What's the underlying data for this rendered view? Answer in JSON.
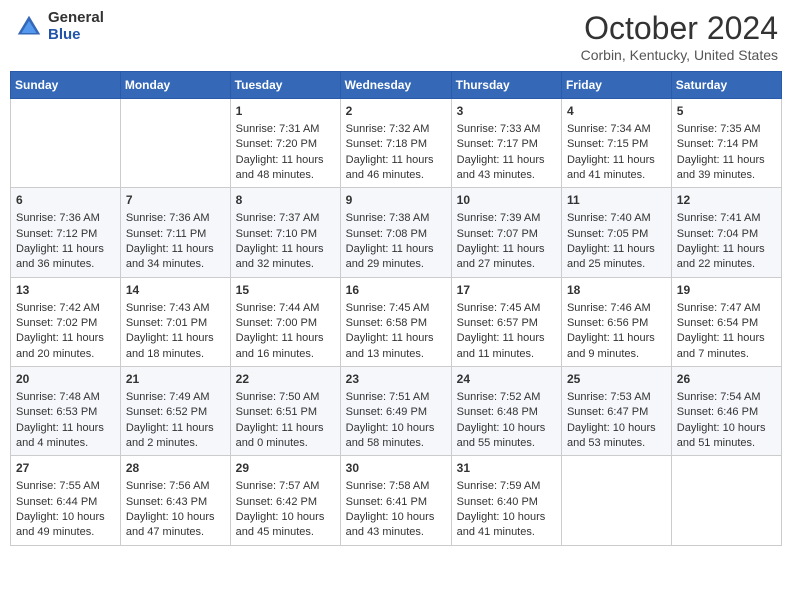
{
  "header": {
    "logo_general": "General",
    "logo_blue": "Blue",
    "month_title": "October 2024",
    "location": "Corbin, Kentucky, United States"
  },
  "days_of_week": [
    "Sunday",
    "Monday",
    "Tuesday",
    "Wednesday",
    "Thursday",
    "Friday",
    "Saturday"
  ],
  "weeks": [
    [
      {
        "day": "",
        "sunrise": "",
        "sunset": "",
        "daylight": ""
      },
      {
        "day": "",
        "sunrise": "",
        "sunset": "",
        "daylight": ""
      },
      {
        "day": "1",
        "sunrise": "Sunrise: 7:31 AM",
        "sunset": "Sunset: 7:20 PM",
        "daylight": "Daylight: 11 hours and 48 minutes."
      },
      {
        "day": "2",
        "sunrise": "Sunrise: 7:32 AM",
        "sunset": "Sunset: 7:18 PM",
        "daylight": "Daylight: 11 hours and 46 minutes."
      },
      {
        "day": "3",
        "sunrise": "Sunrise: 7:33 AM",
        "sunset": "Sunset: 7:17 PM",
        "daylight": "Daylight: 11 hours and 43 minutes."
      },
      {
        "day": "4",
        "sunrise": "Sunrise: 7:34 AM",
        "sunset": "Sunset: 7:15 PM",
        "daylight": "Daylight: 11 hours and 41 minutes."
      },
      {
        "day": "5",
        "sunrise": "Sunrise: 7:35 AM",
        "sunset": "Sunset: 7:14 PM",
        "daylight": "Daylight: 11 hours and 39 minutes."
      }
    ],
    [
      {
        "day": "6",
        "sunrise": "Sunrise: 7:36 AM",
        "sunset": "Sunset: 7:12 PM",
        "daylight": "Daylight: 11 hours and 36 minutes."
      },
      {
        "day": "7",
        "sunrise": "Sunrise: 7:36 AM",
        "sunset": "Sunset: 7:11 PM",
        "daylight": "Daylight: 11 hours and 34 minutes."
      },
      {
        "day": "8",
        "sunrise": "Sunrise: 7:37 AM",
        "sunset": "Sunset: 7:10 PM",
        "daylight": "Daylight: 11 hours and 32 minutes."
      },
      {
        "day": "9",
        "sunrise": "Sunrise: 7:38 AM",
        "sunset": "Sunset: 7:08 PM",
        "daylight": "Daylight: 11 hours and 29 minutes."
      },
      {
        "day": "10",
        "sunrise": "Sunrise: 7:39 AM",
        "sunset": "Sunset: 7:07 PM",
        "daylight": "Daylight: 11 hours and 27 minutes."
      },
      {
        "day": "11",
        "sunrise": "Sunrise: 7:40 AM",
        "sunset": "Sunset: 7:05 PM",
        "daylight": "Daylight: 11 hours and 25 minutes."
      },
      {
        "day": "12",
        "sunrise": "Sunrise: 7:41 AM",
        "sunset": "Sunset: 7:04 PM",
        "daylight": "Daylight: 11 hours and 22 minutes."
      }
    ],
    [
      {
        "day": "13",
        "sunrise": "Sunrise: 7:42 AM",
        "sunset": "Sunset: 7:02 PM",
        "daylight": "Daylight: 11 hours and 20 minutes."
      },
      {
        "day": "14",
        "sunrise": "Sunrise: 7:43 AM",
        "sunset": "Sunset: 7:01 PM",
        "daylight": "Daylight: 11 hours and 18 minutes."
      },
      {
        "day": "15",
        "sunrise": "Sunrise: 7:44 AM",
        "sunset": "Sunset: 7:00 PM",
        "daylight": "Daylight: 11 hours and 16 minutes."
      },
      {
        "day": "16",
        "sunrise": "Sunrise: 7:45 AM",
        "sunset": "Sunset: 6:58 PM",
        "daylight": "Daylight: 11 hours and 13 minutes."
      },
      {
        "day": "17",
        "sunrise": "Sunrise: 7:45 AM",
        "sunset": "Sunset: 6:57 PM",
        "daylight": "Daylight: 11 hours and 11 minutes."
      },
      {
        "day": "18",
        "sunrise": "Sunrise: 7:46 AM",
        "sunset": "Sunset: 6:56 PM",
        "daylight": "Daylight: 11 hours and 9 minutes."
      },
      {
        "day": "19",
        "sunrise": "Sunrise: 7:47 AM",
        "sunset": "Sunset: 6:54 PM",
        "daylight": "Daylight: 11 hours and 7 minutes."
      }
    ],
    [
      {
        "day": "20",
        "sunrise": "Sunrise: 7:48 AM",
        "sunset": "Sunset: 6:53 PM",
        "daylight": "Daylight: 11 hours and 4 minutes."
      },
      {
        "day": "21",
        "sunrise": "Sunrise: 7:49 AM",
        "sunset": "Sunset: 6:52 PM",
        "daylight": "Daylight: 11 hours and 2 minutes."
      },
      {
        "day": "22",
        "sunrise": "Sunrise: 7:50 AM",
        "sunset": "Sunset: 6:51 PM",
        "daylight": "Daylight: 11 hours and 0 minutes."
      },
      {
        "day": "23",
        "sunrise": "Sunrise: 7:51 AM",
        "sunset": "Sunset: 6:49 PM",
        "daylight": "Daylight: 10 hours and 58 minutes."
      },
      {
        "day": "24",
        "sunrise": "Sunrise: 7:52 AM",
        "sunset": "Sunset: 6:48 PM",
        "daylight": "Daylight: 10 hours and 55 minutes."
      },
      {
        "day": "25",
        "sunrise": "Sunrise: 7:53 AM",
        "sunset": "Sunset: 6:47 PM",
        "daylight": "Daylight: 10 hours and 53 minutes."
      },
      {
        "day": "26",
        "sunrise": "Sunrise: 7:54 AM",
        "sunset": "Sunset: 6:46 PM",
        "daylight": "Daylight: 10 hours and 51 minutes."
      }
    ],
    [
      {
        "day": "27",
        "sunrise": "Sunrise: 7:55 AM",
        "sunset": "Sunset: 6:44 PM",
        "daylight": "Daylight: 10 hours and 49 minutes."
      },
      {
        "day": "28",
        "sunrise": "Sunrise: 7:56 AM",
        "sunset": "Sunset: 6:43 PM",
        "daylight": "Daylight: 10 hours and 47 minutes."
      },
      {
        "day": "29",
        "sunrise": "Sunrise: 7:57 AM",
        "sunset": "Sunset: 6:42 PM",
        "daylight": "Daylight: 10 hours and 45 minutes."
      },
      {
        "day": "30",
        "sunrise": "Sunrise: 7:58 AM",
        "sunset": "Sunset: 6:41 PM",
        "daylight": "Daylight: 10 hours and 43 minutes."
      },
      {
        "day": "31",
        "sunrise": "Sunrise: 7:59 AM",
        "sunset": "Sunset: 6:40 PM",
        "daylight": "Daylight: 10 hours and 41 minutes."
      },
      {
        "day": "",
        "sunrise": "",
        "sunset": "",
        "daylight": ""
      },
      {
        "day": "",
        "sunrise": "",
        "sunset": "",
        "daylight": ""
      }
    ]
  ]
}
